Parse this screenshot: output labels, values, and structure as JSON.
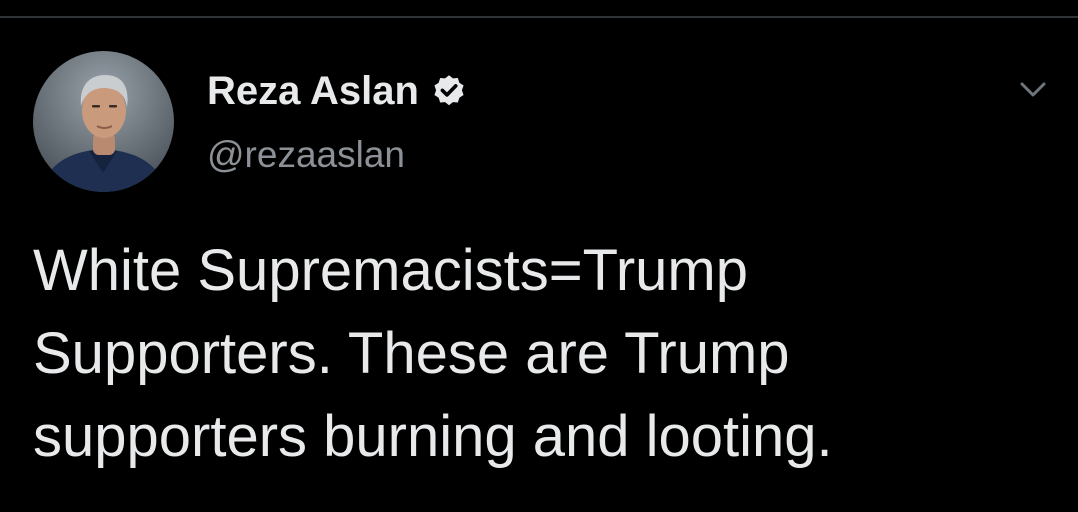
{
  "tweet": {
    "author": {
      "display_name": "Reza Aslan",
      "handle": "@rezaaslan",
      "verified": true
    },
    "text": "White Supremacists=Trump Supporters. These are Trump supporters burning and looting."
  },
  "icons": {
    "verified": "verified-badge-icon",
    "more": "chevron-down-icon"
  },
  "colors": {
    "background": "#000000",
    "primary_text": "#e7e9ea",
    "secondary_text": "#8b9196",
    "divider": "#2f3336"
  }
}
